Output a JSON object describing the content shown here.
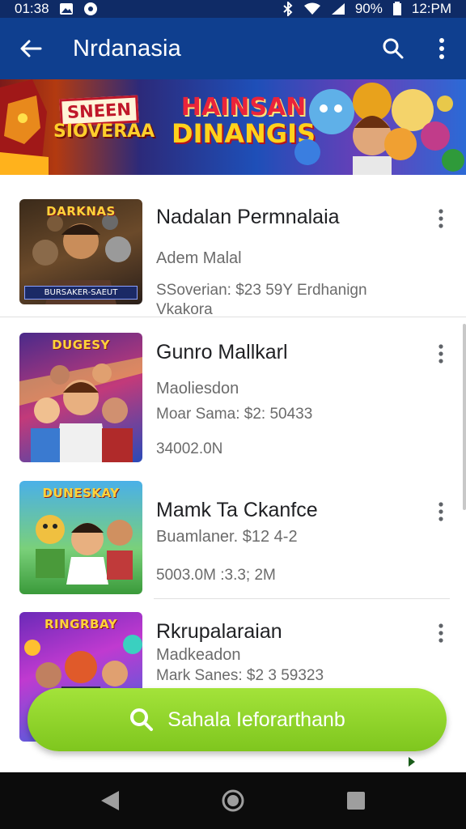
{
  "status_bar": {
    "time": "01:38",
    "battery": "90%",
    "clock_right": "12:PM",
    "icons": [
      "image-icon",
      "record-icon",
      "bluetooth-icon",
      "wifi-icon",
      "signal-icon",
      "battery-icon"
    ]
  },
  "app_bar": {
    "title": "Nrdanasia",
    "back_icon": "arrow-left-icon",
    "search_icon": "search-icon",
    "menu_icon": "more-vert-icon",
    "color": "#0f3f8f"
  },
  "banner": {
    "logo_line1": "SNEEN",
    "logo_line2": "SIOVERAA",
    "title_line1": "HAINSAN",
    "title_line2": "DINANGIS"
  },
  "items": [
    {
      "name": "Nadalan Permnalaia",
      "subtitle": "Adem Malal",
      "meta": "SSoverian: $23 59Y Erdhanign",
      "meta2": "Vkakora",
      "thumb_caption": "DARKNAS",
      "thumb_footer": "BURSAKER-SAEUT"
    },
    {
      "name": "Gunro Mallkarl",
      "subtitle": "Maoliesdon",
      "meta": "Moar Sama: $2: 50433",
      "meta2": "34002.0N",
      "thumb_caption": "DUGESY"
    },
    {
      "name": "Mamk Ta Ckanfce",
      "subtitle": "Buamlaner. $12 4-2",
      "meta": "5003.0M     :3.3; 2M",
      "meta2": "",
      "thumb_caption": "DUNESKAY"
    },
    {
      "name": "Rkrupalaraian",
      "subtitle": "Madkeadon",
      "meta": "Mark Sanes: $2 3 59323",
      "meta2": "",
      "thumb_caption": "RINGRBAY"
    }
  ],
  "fab": {
    "label": "Sahala Ieforarthanb",
    "icon": "search-icon",
    "color": "#8fd42a"
  },
  "nav_bar": {
    "back": "nav-back-icon",
    "home": "nav-home-icon",
    "recents": "nav-recents-icon"
  }
}
